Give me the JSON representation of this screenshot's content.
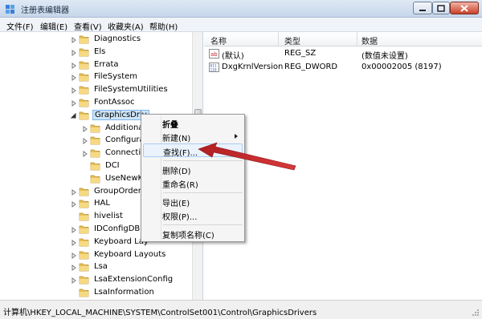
{
  "window": {
    "title": "注册表编辑器"
  },
  "menu": [
    {
      "label": "文件(F)"
    },
    {
      "label": "编辑(E)"
    },
    {
      "label": "查看(V)"
    },
    {
      "label": "收藏夹(A)"
    },
    {
      "label": "帮助(H)"
    }
  ],
  "tree": [
    {
      "label": "Diagnostics",
      "level": 0,
      "expandable": true
    },
    {
      "label": "Els",
      "level": 0,
      "expandable": true
    },
    {
      "label": "Errata",
      "level": 0,
      "expandable": true
    },
    {
      "label": "FileSystem",
      "level": 0,
      "expandable": true
    },
    {
      "label": "FileSystemUtilities",
      "level": 0,
      "expandable": true
    },
    {
      "label": "FontAssoc",
      "level": 0,
      "expandable": true
    },
    {
      "label": "GraphicsDriv",
      "level": 0,
      "expandable": true,
      "expanded": true,
      "selected": true
    },
    {
      "label": "Additiona",
      "level": 1,
      "expandable": true
    },
    {
      "label": "Configura",
      "level": 1,
      "expandable": true
    },
    {
      "label": "Connectiv",
      "level": 1,
      "expandable": true
    },
    {
      "label": "DCI",
      "level": 1,
      "expandable": false
    },
    {
      "label": "UseNewK",
      "level": 1,
      "expandable": false
    },
    {
      "label": "GroupOrderl",
      "level": 0,
      "expandable": true
    },
    {
      "label": "HAL",
      "level": 0,
      "expandable": true
    },
    {
      "label": "hivelist",
      "level": 0,
      "expandable": false
    },
    {
      "label": "IDConfigDB",
      "level": 0,
      "expandable": true
    },
    {
      "label": "Keyboard Lay",
      "level": 0,
      "expandable": true
    },
    {
      "label": "Keyboard Layouts",
      "level": 0,
      "expandable": true
    },
    {
      "label": "Lsa",
      "level": 0,
      "expandable": true
    },
    {
      "label": "LsaExtensionConfig",
      "level": 0,
      "expandable": true
    },
    {
      "label": "LsaInformation",
      "level": 0,
      "expandable": false
    }
  ],
  "list": {
    "columns": [
      "名称",
      "类型",
      "数据"
    ],
    "rows": [
      {
        "icon": "string-value-icon",
        "name": "(默认)",
        "type": "REG_SZ",
        "data": "(数值未设置)"
      },
      {
        "icon": "binary-value-icon",
        "name": "DxgKrnlVersion",
        "type": "REG_DWORD",
        "data": "0x00002005 (8197)"
      }
    ]
  },
  "context_menu": {
    "items": [
      {
        "label": "折叠",
        "bold": true
      },
      {
        "label": "新建(N)",
        "submenu": true
      },
      {
        "label": "查找(F)...",
        "hover": true
      },
      {
        "label": "删除(D)"
      },
      {
        "label": "重命名(R)"
      },
      {
        "label": "导出(E)"
      },
      {
        "label": "权限(P)..."
      },
      {
        "label": "复制项名称(C)"
      }
    ]
  },
  "status": {
    "path": "计算机\\HKEY_LOCAL_MACHINE\\SYSTEM\\ControlSet001\\Control\\GraphicsDrivers"
  },
  "colors": {
    "annotation_arrow": "#c0282a",
    "folder": "#e8c25a",
    "selection": "#cde4f7"
  }
}
